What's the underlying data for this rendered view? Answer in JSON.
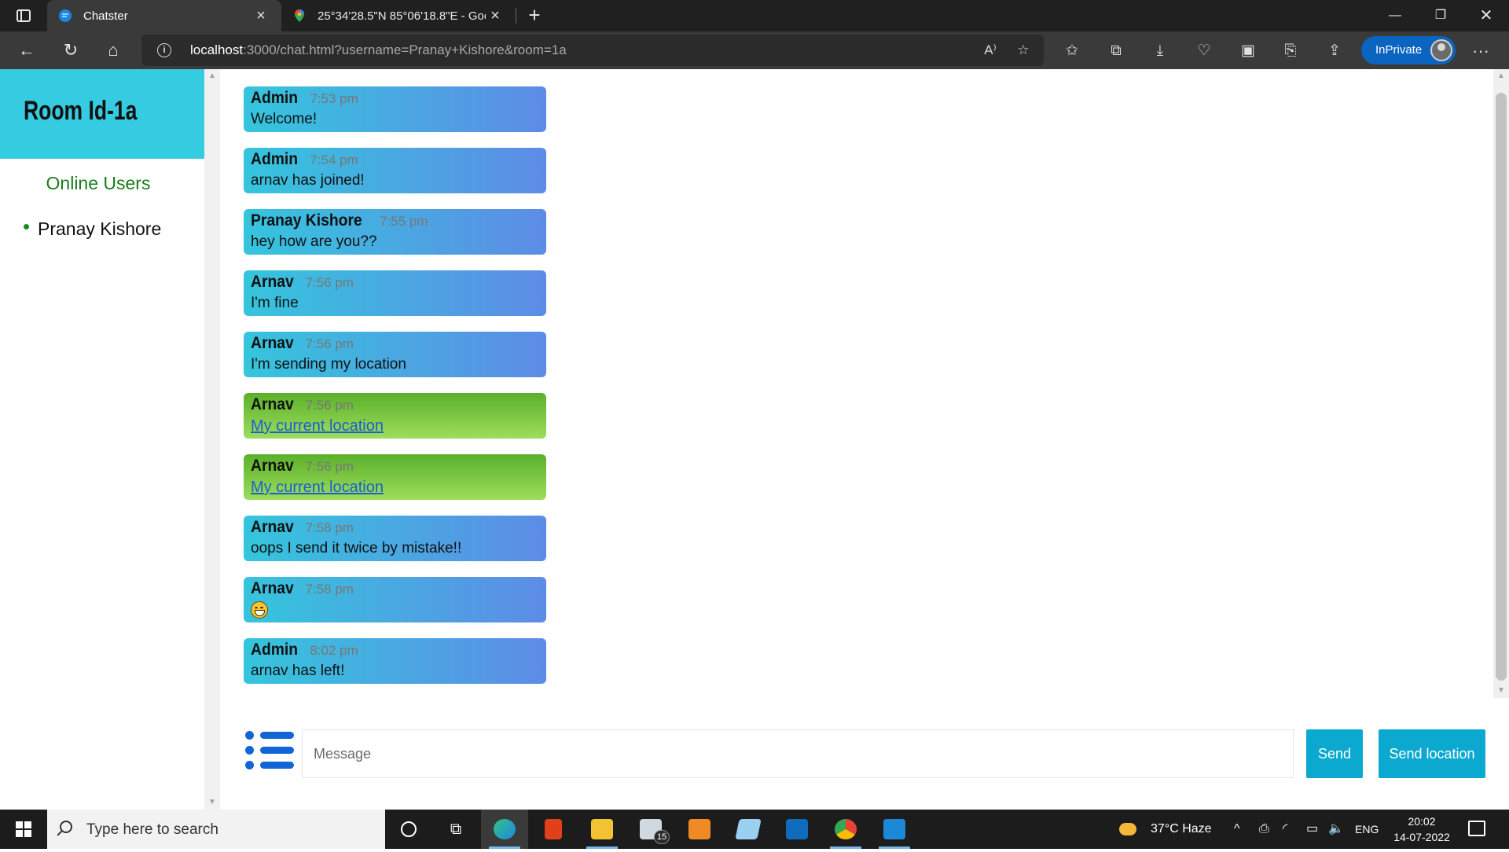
{
  "browser": {
    "tabs": [
      {
        "title": "Chatster",
        "active": true
      },
      {
        "title": "25°34'28.5\"N 85°06'18.8\"E - Goo",
        "active": false
      }
    ],
    "url_host": "localhost",
    "url_rest": ":3000/chat.html?username=Pranay+Kishore&room=1a",
    "inprivate_label": "InPrivate"
  },
  "sidebar": {
    "room_title": "Room Id-1a",
    "online_users_title": "Online Users",
    "users": [
      "Pranay Kishore"
    ]
  },
  "messages": [
    {
      "name": "Admin",
      "time": "7:53 pm",
      "text": "Welcome!",
      "type": "text"
    },
    {
      "name": "Admin",
      "time": "7:54 pm",
      "text": "arnav has joined!",
      "type": "text"
    },
    {
      "name": "Pranay Kishore",
      "time": "7:55 pm",
      "text": "hey how are you??",
      "type": "text"
    },
    {
      "name": "Arnav",
      "time": "7:56 pm",
      "text": "I'm fine",
      "type": "text"
    },
    {
      "name": "Arnav",
      "time": "7:56 pm",
      "text": "I'm sending my location",
      "type": "text"
    },
    {
      "name": "Arnav",
      "time": "7:56 pm",
      "text": "My current location",
      "type": "location"
    },
    {
      "name": "Arnav",
      "time": "7:56 pm",
      "text": "My current location",
      "type": "location"
    },
    {
      "name": "Arnav",
      "time": "7:58 pm",
      "text": "oops I send it twice by mistake!!",
      "type": "text"
    },
    {
      "name": "Arnav",
      "time": "7:58 pm",
      "text": "",
      "type": "emoji"
    },
    {
      "name": "Admin",
      "time": "8:02 pm",
      "text": "arnav has left!",
      "type": "text"
    }
  ],
  "compose": {
    "placeholder": "Message",
    "send_label": "Send",
    "send_location_label": "Send location"
  },
  "taskbar": {
    "search_placeholder": "Type here to search",
    "mail_badge": "15",
    "weather": "37°C  Haze",
    "language": "ENG",
    "time": "20:02",
    "date": "14-07-2022"
  },
  "colors": {
    "room_header": "#35cbe0",
    "message_gradient_start": "#35c5dd",
    "message_gradient_end": "#5d8ce6",
    "location_gradient_start": "#5ab02a",
    "location_gradient_end": "#9edd5c",
    "button": "#0ba9d0",
    "online_users": "#1a7d1a"
  }
}
